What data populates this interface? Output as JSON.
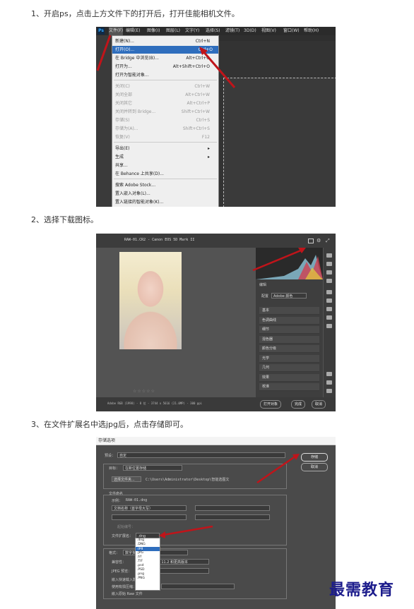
{
  "steps": [
    "1、开启ps，点击上方文件下的打开后，打开佳能相机文件。",
    "2、选择下载图标。",
    "3、在文件扩展名中选jpg后，点击存储即可。"
  ],
  "shot1": {
    "logo": "Ps",
    "menus": [
      "文件(F)",
      "编辑(E)",
      "图像(I)",
      "图层(L)",
      "文字(Y)",
      "选择(S)",
      "滤镜(T)",
      "3D(D)",
      "视图(V)",
      "窗口(W)",
      "帮助(H)"
    ],
    "file_menu": [
      {
        "label": "新建(N)...",
        "shortcut": "Ctrl+N",
        "state": "normal"
      },
      {
        "label": "打开(O)...",
        "shortcut": "Ctrl+O",
        "state": "highlight"
      },
      {
        "label": "在 Bridge 中浏览(B)...",
        "shortcut": "Alt+Ctrl+O",
        "state": "normal"
      },
      {
        "label": "打开为...",
        "shortcut": "Alt+Shift+Ctrl+O",
        "state": "normal"
      },
      {
        "label": "打开为智能对象...",
        "shortcut": "",
        "state": "normal"
      },
      {
        "label": "关闭(C)",
        "shortcut": "Ctrl+W",
        "state": "disabled"
      },
      {
        "label": "关闭全部",
        "shortcut": "Alt+Ctrl+W",
        "state": "disabled"
      },
      {
        "label": "关闭其它",
        "shortcut": "Alt+Ctrl+P",
        "state": "disabled"
      },
      {
        "label": "关闭并转到 Bridge...",
        "shortcut": "Shift+Ctrl+W",
        "state": "disabled"
      },
      {
        "label": "存储(S)",
        "shortcut": "Ctrl+S",
        "state": "disabled"
      },
      {
        "label": "存储为(A)...",
        "shortcut": "Shift+Ctrl+S",
        "state": "disabled"
      },
      {
        "label": "恢复(V)",
        "shortcut": "F12",
        "state": "disabled"
      },
      {
        "label": "导出(E)",
        "shortcut": "",
        "state": "submenu"
      },
      {
        "label": "生成",
        "shortcut": "",
        "state": "submenu"
      },
      {
        "label": "共享...",
        "shortcut": "",
        "state": "normal"
      },
      {
        "label": "在 Behance 上共享(D)...",
        "shortcut": "",
        "state": "normal"
      },
      {
        "label": "搜索 Adobe Stock...",
        "shortcut": "",
        "state": "normal"
      },
      {
        "label": "置入嵌入对象(L)...",
        "shortcut": "",
        "state": "normal"
      },
      {
        "label": "置入链接的智能对象(K)...",
        "shortcut": "",
        "state": "normal"
      }
    ]
  },
  "shot2": {
    "title": "RAW-01.CR2 -  Canon EOS 5D Mark II",
    "panel_header": "编辑",
    "profile_label": "配置",
    "profile_value": "Adobe 颜色",
    "panels": [
      "基本",
      "色调曲线",
      "细节",
      "混色器",
      "颜色分级",
      "光学",
      "几何",
      "效果",
      "校准"
    ],
    "status": "Adobe RGB (1998) - 8 位 - 3744 x 5616 (21.0MP) - 300 ppi",
    "open_btn": "打开对象",
    "done_btn": "完成",
    "cancel_btn": "取消",
    "stars": "☆☆☆☆☆"
  },
  "shot3": {
    "title": "存储选项",
    "preset_label": "预设：",
    "preset_value": "自定",
    "save_btn": "存储",
    "cancel_btn": "取消",
    "dest_label": "目标：",
    "dest_value": "在新位置存储",
    "choose_folder": "选择文件夹...",
    "folder_path": "C:\\Users\\Administrator\\Desktop\\智能选图文",
    "naming_label": "文件命名",
    "example_label": "示例：",
    "example_value": "RAW-01.dng",
    "doc_name": "文档名称（首字母大写）",
    "start_num_label": "起始编号：",
    "ext_label": "文件扩展名：",
    "ext_value": ".dng",
    "ext_options": [
      ".dng",
      ".DNG",
      ".jpg",
      ".JPG",
      ".tif",
      ".TIF",
      ".psd",
      ".PSD",
      ".png",
      ".PNG"
    ],
    "format_label": "格式：",
    "format_value": "数字负片",
    "compat_label": "兼容性：",
    "compat_value": "Camera Raw 11.2 和更高版本",
    "jpeg_label": "JPEG 预览：",
    "embed_fast": "嵌入快速载入数据",
    "lossy": "使用有损压缩：",
    "embed_raw": "嵌入原始 Raw 文件"
  },
  "watermark": "最需教育"
}
